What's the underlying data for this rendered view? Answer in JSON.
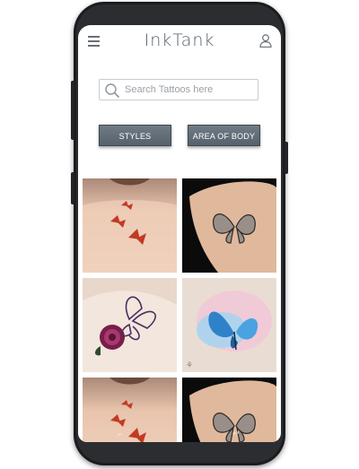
{
  "app": {
    "title": "InkTank"
  },
  "header": {
    "menu_icon": "hamburger-menu-icon",
    "account_icon": "user-icon"
  },
  "search": {
    "placeholder": "Search Tattoos here",
    "icon": "search-icon"
  },
  "filters": {
    "styles_label": "STYLES",
    "body_label": "AREA OF BODY"
  },
  "gallery": {
    "items": [
      {
        "subject": "red butterflies upper back tattoo"
      },
      {
        "subject": "black butterfly arm tattoo"
      },
      {
        "subject": "purple rose and butterfly shoulder tattoo"
      },
      {
        "subject": "blue watercolor butterfly tattoo"
      },
      {
        "subject": "red butterflies upper back tattoo"
      },
      {
        "subject": "black butterfly arm tattoo"
      }
    ]
  },
  "colors": {
    "button": "#5f6a75",
    "logo": "#55606b",
    "phone_frame": "#1b1c1f"
  }
}
